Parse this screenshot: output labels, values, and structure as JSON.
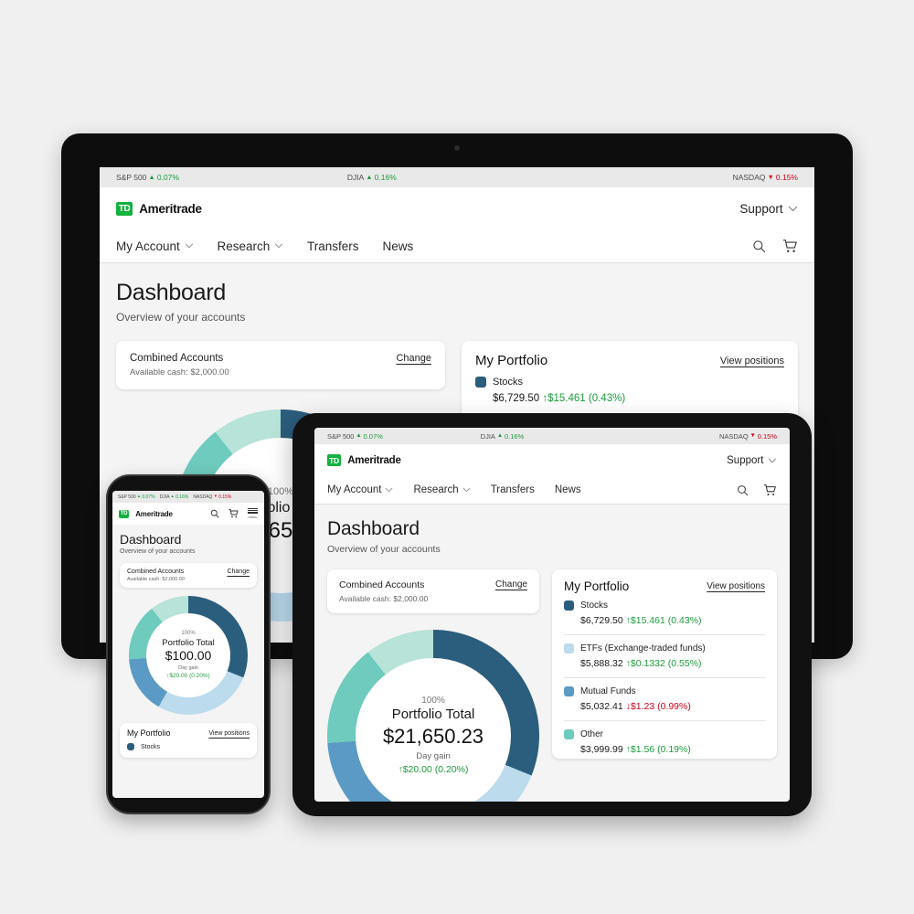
{
  "ticker": {
    "items": [
      {
        "name": "S&P 500",
        "dir": "up",
        "arrow": "▲",
        "value": "0.07%"
      },
      {
        "name": "DJIA",
        "dir": "up",
        "arrow": "▲",
        "value": "0.16%"
      },
      {
        "name": "NASDAQ",
        "dir": "down",
        "arrow": "▼",
        "value": "0.15%"
      }
    ]
  },
  "brand": {
    "mark": "TD",
    "word": "Ameritrade"
  },
  "header": {
    "support_label": "Support",
    "caret": "⌵",
    "search_icon": "search-icon",
    "cart_icon": "cart-icon",
    "menu_label": "menu"
  },
  "nav": {
    "items": [
      {
        "label": "My Account",
        "caret": true
      },
      {
        "label": "Research",
        "caret": true
      },
      {
        "label": "Transfers",
        "caret": false
      },
      {
        "label": "News",
        "caret": false
      }
    ]
  },
  "page": {
    "title": "Dashboard",
    "subtitle": "Overview of your accounts"
  },
  "account_card": {
    "name": "Combined Accounts",
    "cash": "Available cash: $2,000.00",
    "change_label": "Change"
  },
  "portfolio": {
    "title": "My Portfolio",
    "view_positions": "View positions",
    "assets": [
      {
        "label": "Stocks",
        "color": "#2b5d7d",
        "amount": "$6,729.50",
        "arrow": "↑",
        "delta": "$15.461 (0.43%)",
        "dir": "up"
      },
      {
        "label": "ETFs (Exchange-traded funds)",
        "color": "#bcdcee",
        "amount": "$5,888.32",
        "arrow": "↑",
        "delta": "$0.1332 (0.55%)",
        "dir": "up"
      },
      {
        "label": "Mutual Funds",
        "color": "#5b9ac4",
        "amount": "$5,032.41",
        "arrow": "↓",
        "delta": "$1.23 (0.99%)",
        "dir": "down"
      },
      {
        "label": "Other",
        "color": "#6ecbbd",
        "amount": "$3,999.99",
        "arrow": "↑",
        "delta": "$1.56 (0.19%)",
        "dir": "up"
      }
    ]
  },
  "donut": {
    "pct": "100%",
    "total_label": "Portfolio Total",
    "day_gain_label": "Day gain",
    "day_gain_arrow": "↑",
    "day_gain_value": "$20.00 (0.20%)",
    "desktop_total": "$21,650.23",
    "tablet_total": "$21,650.23",
    "phone_total": "$100.00"
  },
  "chart_data": {
    "type": "pie",
    "title": "Portfolio Total",
    "center_value": "$21,650.23",
    "center_pct": "100%",
    "legend_position": "right",
    "categories": [
      "Stocks",
      "ETFs (Exchange-traded funds)",
      "Mutual Funds",
      "Other",
      "Cash"
    ],
    "values": [
      31.1,
      27.2,
      23.2,
      18.5,
      9.2
    ],
    "colors": [
      "#2b5d7d",
      "#bcdcee",
      "#5b9ac4",
      "#6ecbbd",
      "#b8e3d8"
    ],
    "labels": [
      "$6,729.50",
      "$5,888.32",
      "$5,032.41",
      "$3,999.99",
      "$2,000.00"
    ]
  },
  "colors": {
    "brand_green": "#12b23f",
    "up_green": "#1c9c3c",
    "down_red": "#d0021b",
    "page_bg": "#f4f4f4",
    "ticker_bg": "#e9e9e9"
  }
}
